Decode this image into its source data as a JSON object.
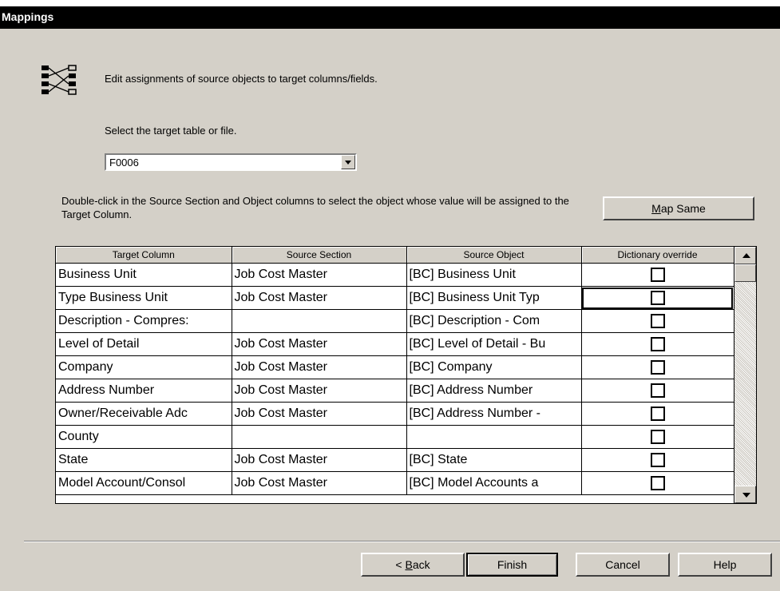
{
  "window": {
    "title": "Mappings"
  },
  "instructions": "Edit assignments of source objects to target columns/fields.",
  "target_select": {
    "label": "Select the target table or file.",
    "value": "F0006"
  },
  "hint": "Double-click in the Source Section and Object columns to select the object whose value will be assigned to the Target Column.",
  "map_same": {
    "prefix": "",
    "accel": "M",
    "rest": "ap Same"
  },
  "grid": {
    "columns": [
      "Target Column",
      "Source Section",
      "Source Object",
      "Dictionary override"
    ],
    "rows": [
      {
        "target": "Business Unit",
        "section": "Job Cost Master",
        "object": "[BC] Business Unit",
        "override": false
      },
      {
        "target": "Type Business Unit",
        "section": "Job Cost Master",
        "object": "[BC] Business Unit Typ",
        "override": false
      },
      {
        "target": "Description - Compres:",
        "section": "",
        "object": "[BC] Description - Com",
        "override": false
      },
      {
        "target": "Level of Detail",
        "section": "Job Cost Master",
        "object": "[BC] Level of Detail - Bu",
        "override": false
      },
      {
        "target": "Company",
        "section": "Job Cost Master",
        "object": "[BC] Company",
        "override": false
      },
      {
        "target": "Address Number",
        "section": "Job Cost Master",
        "object": "[BC] Address Number",
        "override": false
      },
      {
        "target": "Owner/Receivable Adc",
        "section": "Job Cost Master",
        "object": "[BC] Address Number -",
        "override": false
      },
      {
        "target": "County",
        "section": "",
        "object": "",
        "override": false
      },
      {
        "target": "State",
        "section": "Job Cost Master",
        "object": "[BC] State",
        "override": false
      },
      {
        "target": "Model Account/Consol",
        "section": "Job Cost Master",
        "object": "[BC] Model Accounts a",
        "override": false
      }
    ]
  },
  "buttons": {
    "back": {
      "prefix": "< ",
      "accel": "B",
      "rest": "ack"
    },
    "finish": "Finish",
    "cancel": "Cancel",
    "help": "Help"
  },
  "icons": {
    "wizard": "mapping-icon",
    "dropdown": "chevron-down-icon",
    "scroll_up": "arrow-up-icon",
    "scroll_down": "arrow-down-icon"
  }
}
